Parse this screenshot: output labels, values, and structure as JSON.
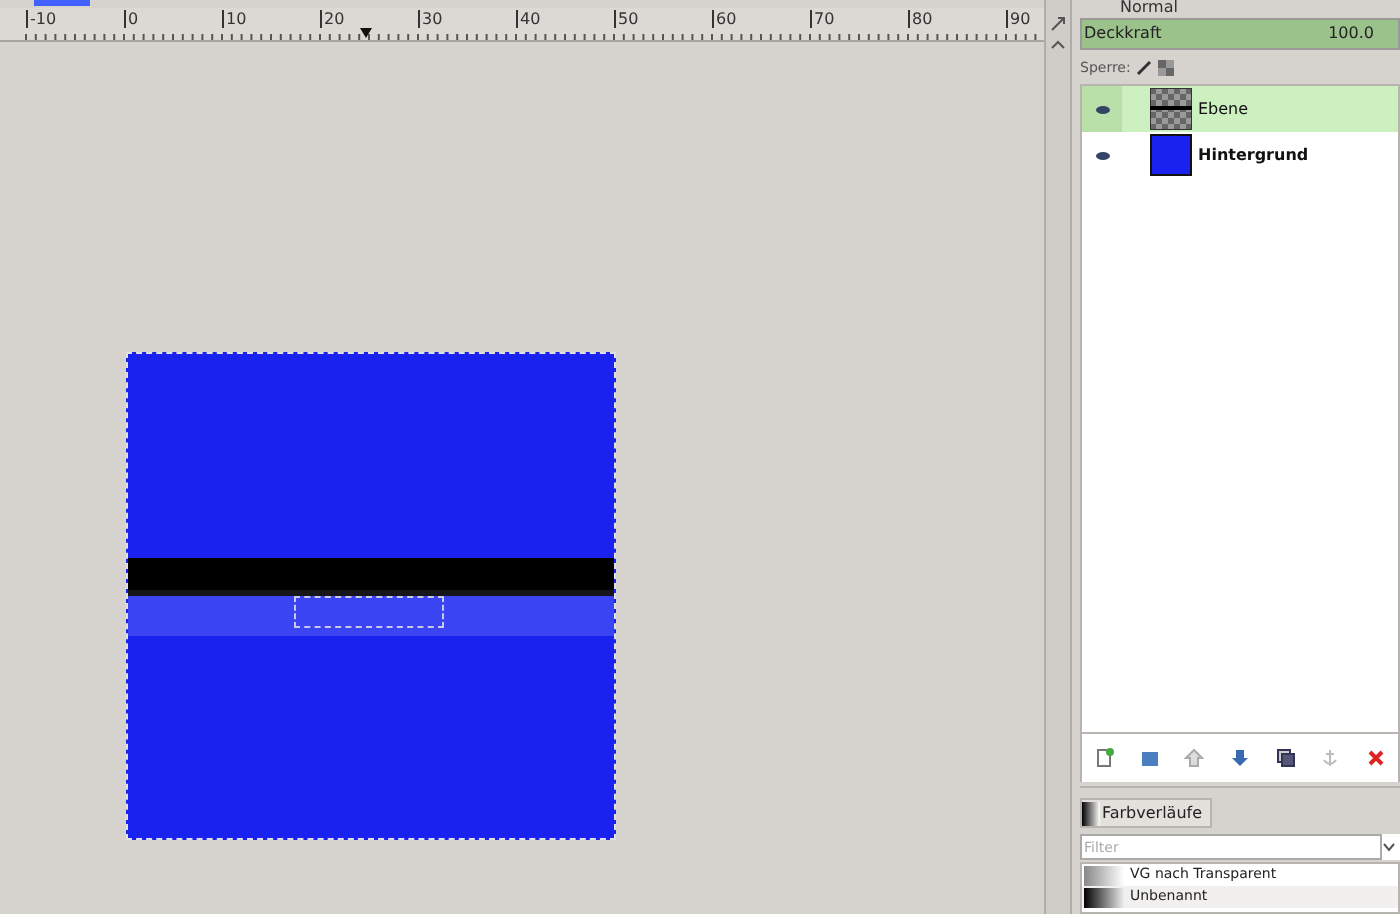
{
  "ruler": {
    "labels": [
      "-10",
      "0",
      "10",
      "20",
      "30",
      "40",
      "50",
      "60",
      "70",
      "80",
      "90"
    ]
  },
  "layers_panel": {
    "mode": "Normal",
    "opacity": {
      "label": "Deckkraft",
      "value": "100.0",
      "level": 1.0
    },
    "lock_label": "Sperre:",
    "layers": [
      {
        "name": "Ebene",
        "kind": "transparent",
        "selected": true,
        "visible": true
      },
      {
        "name": "Hintergrund",
        "kind": "filled",
        "selected": false,
        "visible": true
      }
    ]
  },
  "gradients_panel": {
    "tab": "Farbverläufe",
    "filter_placeholder": "Filter",
    "items": [
      {
        "name": "VG nach Transparent",
        "kind": "fade"
      },
      {
        "name": "Unbenannt",
        "kind": "dark"
      }
    ]
  }
}
